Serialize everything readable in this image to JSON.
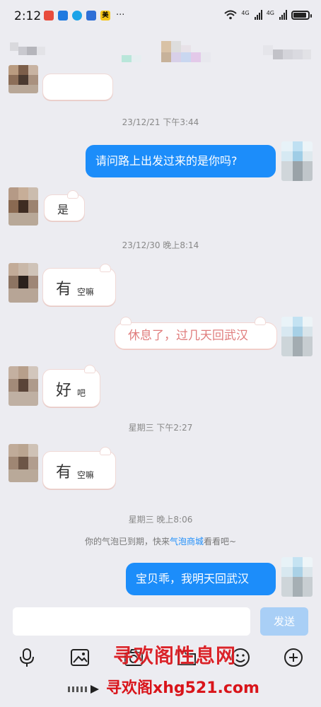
{
  "status_bar": {
    "time": "2:12",
    "app_icon_colors": [
      "#e84c3d",
      "#1f7ae0",
      "#1aa3e8",
      "#2f6fd6",
      "#f5c518"
    ],
    "app_badge_text": "美",
    "more": "···",
    "net_labels": [
      "4G",
      "4G"
    ],
    "battery_level": 0.9
  },
  "chat": {
    "timestamps": [
      "23/12/21 下午3:44",
      "23/12/30 晚上8:14",
      "星期三 下午2:27",
      "星期三 晚上8:06"
    ],
    "messages": {
      "m1": "请问路上出发过来的是你吗?",
      "m2": "是",
      "m3_big": "有",
      "m3_small": "空嘛",
      "m4": "休息了，过几天回武汉",
      "m5_big": "好",
      "m5_small": "吧",
      "m6_big": "有",
      "m6_small": "空嘛",
      "m7": "宝贝乖，我明天回武汉"
    },
    "notice": {
      "before": "你的气泡已到期，快来",
      "link": "气泡商城",
      "after": "看看吧~"
    }
  },
  "input": {
    "placeholder": "",
    "send_label": "发送"
  },
  "toolbar": {
    "icons": [
      "microphone-icon",
      "image-icon",
      "camera-icon",
      "folder-icon",
      "emoji-icon",
      "plus-icon"
    ]
  },
  "watermark": {
    "line1": "寻欢阁性息网",
    "line2": "寻欢阁xhg521.com"
  },
  "colors": {
    "accent": "#1c8dfa",
    "background": "#ececf1",
    "pink_text": "#e07d7d"
  }
}
